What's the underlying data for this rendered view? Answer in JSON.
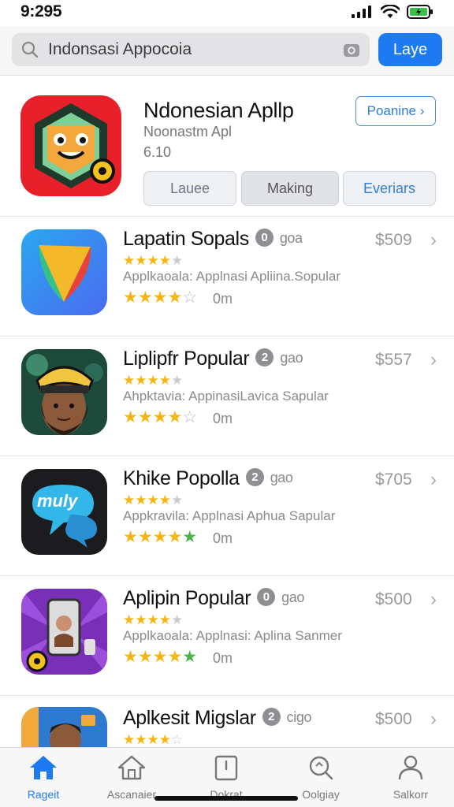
{
  "status": {
    "time": "9:295"
  },
  "search": {
    "query": "Indonsasi Appocoia",
    "button_label": "Laye"
  },
  "featured": {
    "title": "Ndonesian Apllp",
    "subtitle": "Noonastm Apl",
    "version": "6.10",
    "link_label": "Poanine ›",
    "segments": [
      "Lauee",
      "Making",
      "Everiars"
    ]
  },
  "apps": [
    {
      "name": "Lapatin Sopals",
      "age": "0",
      "tag": "goa",
      "price": "$509",
      "desc": "Applkaoala: Applnasi Apliina.Sopular",
      "meta": "0m",
      "rating_small": 5,
      "rating_big": 4
    },
    {
      "name": "Liplipfr Popular",
      "age": "2",
      "tag": "gao",
      "price": "$557",
      "desc": "Ahpktavia: AppinasiLavica Sapular",
      "meta": "0m",
      "rating_small": 5,
      "rating_big": 4
    },
    {
      "name": "Khike Popolla",
      "age": "2",
      "tag": "gao",
      "price": "$705",
      "desc": "Appkravila: Applnasi Aphua Sapular",
      "meta": "0m",
      "rating_small": 5,
      "rating_big": 5
    },
    {
      "name": "Aplipin Popular",
      "age": "0",
      "tag": "gao",
      "price": "$500",
      "desc": "Applkaoala: Applnasi: Aplina Sanmer",
      "meta": "0m",
      "rating_small": 5,
      "rating_big": 5
    },
    {
      "name": "Aplkesit Migslar",
      "age": "2",
      "tag": "cigo",
      "price": "$500",
      "desc": "",
      "meta": "",
      "rating_small": 5,
      "rating_big": 0
    }
  ],
  "tabs": [
    {
      "label": "Rageit",
      "icon": "home-icon",
      "active": true
    },
    {
      "label": "Ascanaier",
      "icon": "apps-icon",
      "active": false
    },
    {
      "label": "Dokrat",
      "icon": "bookmark-icon",
      "active": false
    },
    {
      "label": "Oolgiay",
      "icon": "search-icon",
      "active": false
    },
    {
      "label": "Salkorr",
      "icon": "person-icon",
      "active": false
    }
  ],
  "colors": {
    "accent": "#1e7af0",
    "star": "#f5b614",
    "star_green": "#4bb34b"
  }
}
